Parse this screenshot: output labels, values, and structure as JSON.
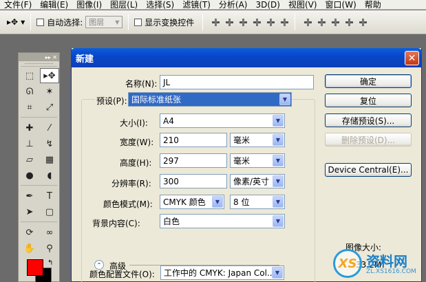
{
  "menubar": {
    "items": [
      "文件(F)",
      "编辑(E)",
      "图像(I)",
      "图层(L)",
      "选择(S)",
      "滤镜(T)",
      "分析(A)",
      "3D(D)",
      "视图(V)",
      "窗口(W)",
      "帮助"
    ]
  },
  "options": {
    "auto_select_label": "自动选择:",
    "auto_select_value": "图层",
    "show_transform_label": "显示变换控件"
  },
  "toolbox": {
    "foreground_color": "#ff0000",
    "background_color": "#000000"
  },
  "dialog": {
    "title": "新建",
    "name_label": "名称(N):",
    "name_value": "JL",
    "preset_label": "预设(P):",
    "preset_value": "国际标准纸张",
    "size_label": "大小(I):",
    "size_value": "A4",
    "width_label": "宽度(W):",
    "width_value": "210",
    "width_unit": "毫米",
    "height_label": "高度(H):",
    "height_value": "297",
    "height_unit": "毫米",
    "resolution_label": "分辨率(R):",
    "resolution_value": "300",
    "resolution_unit": "像素/英寸",
    "color_mode_label": "颜色模式(M):",
    "color_mode_value": "CMYK 颜色",
    "bit_depth_value": "8 位",
    "bg_contents_label": "背景内容(C):",
    "bg_contents_value": "白色",
    "advanced_label": "高级",
    "color_profile_label": "颜色配置文件(O):",
    "color_profile_value": "工作中的 CMYK: Japan Col...",
    "buttons": {
      "ok": "确定",
      "reset": "复位",
      "save_preset": "存储预设(S)...",
      "delete_preset": "删除预设(D)...",
      "device_central": "Device Central(E)..."
    },
    "image_size_label": "图像大小:",
    "image_size_value": "33.2M"
  },
  "watermark": {
    "logo": "XS",
    "text": "资料网",
    "url": "ZL.XS1616.COM"
  }
}
